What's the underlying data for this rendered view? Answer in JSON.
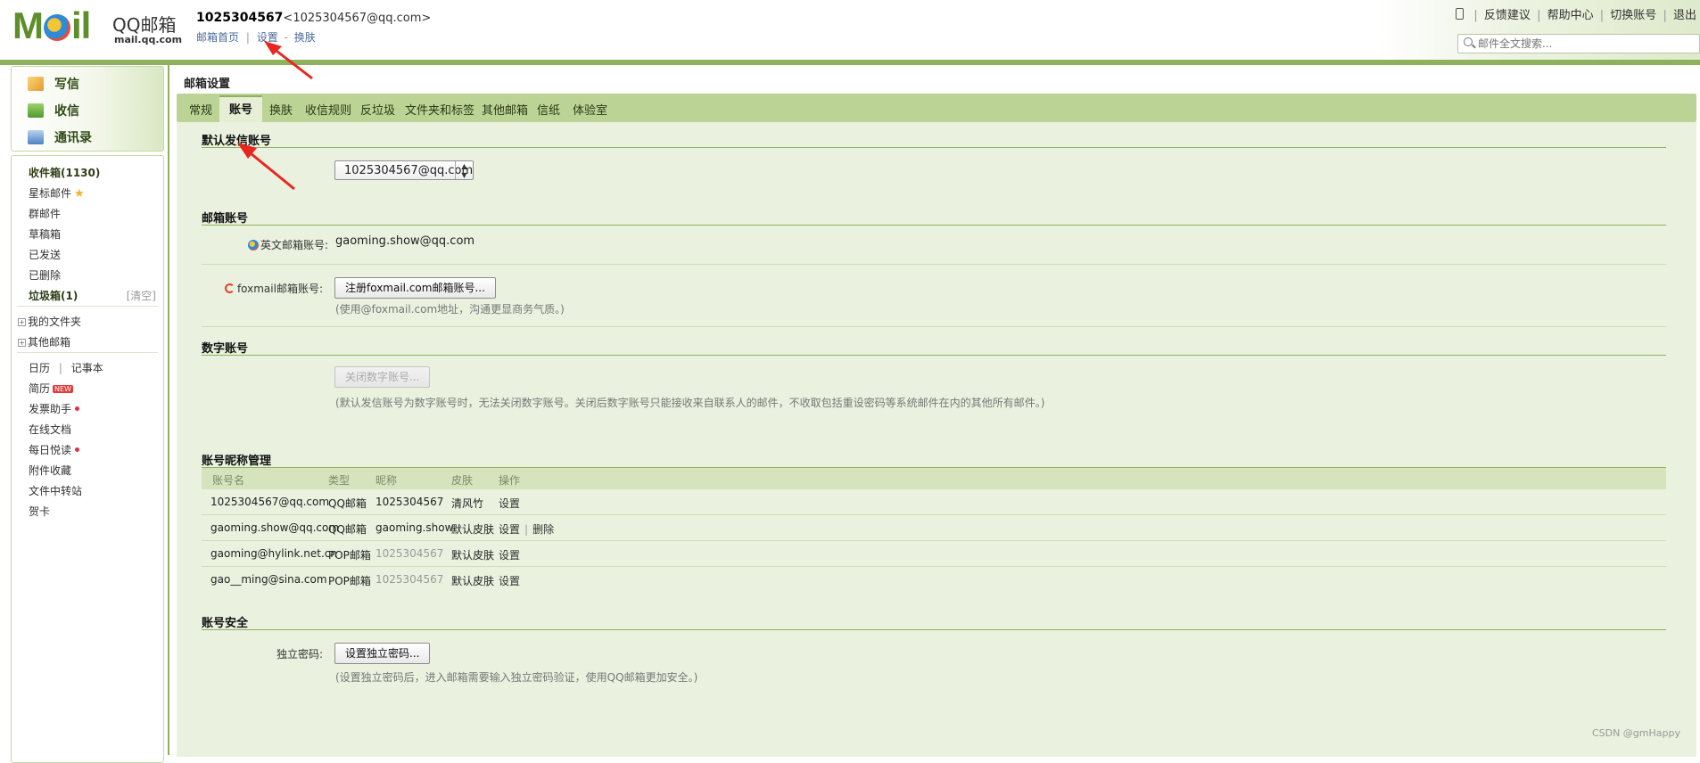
{
  "header": {
    "logo_text": "M  il",
    "brand": "QQ邮箱",
    "brand_domain": "mail.qq.com",
    "user_id": "1025304567",
    "user_email": "<1025304567@qq.com>",
    "links": {
      "home": "邮箱首页",
      "sep": "|",
      "settings": "设置",
      "dash": "-",
      "skin": "换肤"
    },
    "top_links": [
      "反馈建议",
      "帮助中心",
      "切换账号",
      "退出"
    ],
    "top_sep": "|",
    "search_placeholder": "邮件全文搜索..."
  },
  "quick": {
    "write": "写信",
    "receive": "收信",
    "contacts": "通讯录"
  },
  "nav": {
    "inbox": "收件箱(1130)",
    "starred": "星标邮件",
    "group": "群邮件",
    "drafts": "草稿箱",
    "sent": "已发送",
    "deleted": "已删除",
    "spam": "垃圾箱(1)",
    "spam_clear": "[清空]",
    "my_folders": "我的文件夹",
    "other_mailbox": "其他邮箱",
    "calendar": "日历",
    "cal_sep": "|",
    "notes": "记事本",
    "resume": "简历",
    "new_badge": "NEW",
    "invoice": "发票助手",
    "online_docs": "在线文档",
    "daily_reading": "每日悦读",
    "attachments": "附件收藏",
    "file_transfer": "文件中转站",
    "cards": "贺卡"
  },
  "main": {
    "title": "邮箱设置",
    "tabs": [
      "常规",
      "账号",
      "换肤",
      "收信规则",
      "反垃圾",
      "文件夹和标签",
      "其他邮箱",
      "信纸",
      "体验室"
    ],
    "active_tab": "账号"
  },
  "sections": {
    "default_sender": {
      "title": "默认发信账号",
      "selected": "1025304567@qq.com"
    },
    "mail_accounts": {
      "title": "邮箱账号",
      "english_label": "英文邮箱账号:",
      "english_value": "gaoming.show@qq.com",
      "foxmail_label": "foxmail邮箱账号:",
      "foxmail_button": "注册foxmail.com邮箱账号...",
      "foxmail_hint": "(使用@foxmail.com地址，沟通更显商务气质。)"
    },
    "digital": {
      "title": "数字账号",
      "button": "关闭数字账号...",
      "hint": "(默认发信账号为数字账号时，无法关闭数字账号。关闭后数字账号只能接收来自联系人的邮件，不收取包括重设密码等系统邮件在内的其他所有邮件。)"
    },
    "nickname": {
      "title": "账号昵称管理",
      "columns": [
        "账号名",
        "类型",
        "昵称",
        "皮肤",
        "操作"
      ],
      "rows": [
        {
          "account": "1025304567@qq.com",
          "type": "QQ邮箱",
          "nickname": "1025304567",
          "skin": "清风竹",
          "op1": "设置",
          "op2": ""
        },
        {
          "account": "gaoming.show@qq.com",
          "type": "QQ邮箱",
          "nickname": "gaoming.show",
          "skin": "默认皮肤",
          "op1": "设置",
          "op2": "删除"
        },
        {
          "account": "gaoming@hylink.net.cn",
          "type": "POP邮箱",
          "nickname": "1025304567",
          "skin": "默认皮肤",
          "op1": "设置",
          "op2": ""
        },
        {
          "account": "gao__ming@sina.com",
          "type": "POP邮箱",
          "nickname": "1025304567",
          "skin": "默认皮肤",
          "op1": "设置",
          "op2": ""
        }
      ],
      "op_sep": "|"
    },
    "security": {
      "title": "账号安全",
      "pwd_label": "独立密码:",
      "pwd_button": "设置独立密码...",
      "pwd_hint": "(设置独立密码后，进入邮箱需要输入独立密码验证，使用QQ邮箱更加安全。)"
    }
  },
  "watermark": "CSDN @gmHappy",
  "colors": {
    "accent_green": "#8eb25b",
    "tab_bar": "#bcd396",
    "content_bg": "#eaf2df",
    "annotation_red": "#e8261f"
  },
  "icons": [
    "phone-icon",
    "search-icon",
    "write-icon",
    "receive-icon",
    "contacts-icon",
    "star-icon",
    "qq-icon",
    "foxmail-icon",
    "red-arrow"
  ]
}
